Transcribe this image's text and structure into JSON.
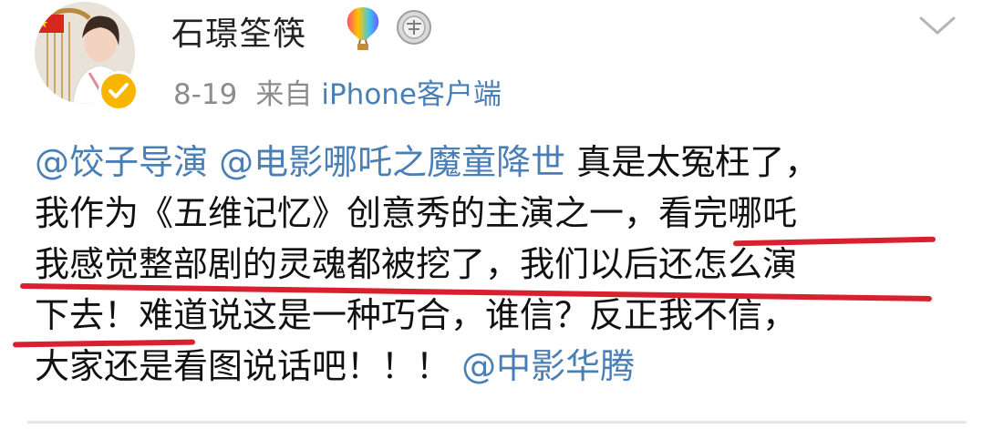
{
  "user": {
    "name": "石璟筌筷",
    "avatar": "avatar",
    "verified_icon": "verified-badge-icon",
    "badges": [
      "hot-air-balloon-icon",
      "medal-icon"
    ]
  },
  "post": {
    "date": "8-19",
    "source_prefix": "来自",
    "source": "iPhone客户端",
    "lines": [
      {
        "mention1": "@饺子导演",
        "mention2": "@电影哪吒之魔童降世",
        "text": " 真是太冤枉了，"
      },
      {
        "text": "我作为《五维记忆》创意秀的主演之一，看完哪吒"
      },
      {
        "text": "我感觉整部剧的灵魂都被挖了，我们以后还怎么演"
      },
      {
        "text": "下去！难道说这是一种巧合，谁信？反正我不信，"
      },
      {
        "text": "大家还是看图说话吧！！！ ",
        "mention": "@中影华腾"
      }
    ]
  },
  "controls": {
    "expand_icon": "chevron-down-icon"
  },
  "colors": {
    "mention": "#4a7fb5",
    "meta": "#8c8c8c",
    "underline": "#d9202f",
    "verified": "#f7b500"
  }
}
